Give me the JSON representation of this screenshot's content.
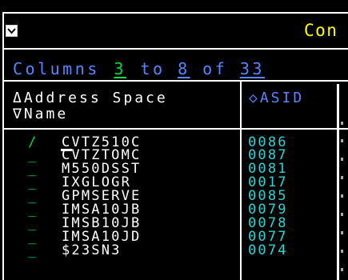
{
  "header": {
    "title": "Con",
    "checkbox_icon": "chevron-down-icon"
  },
  "columns_nav": {
    "prefix": "Columns",
    "from_value": "3",
    "to_word": "to",
    "to_value": "8",
    "of_word": "of",
    "total": "33"
  },
  "table": {
    "headers": {
      "name_line1": "ΔAddress Space",
      "name_line2": "∇Name",
      "asid": "◇ASID"
    },
    "rows": [
      {
        "sel": "/",
        "name": "CVTZ510C",
        "asid": "0086"
      },
      {
        "sel": "_",
        "name": "CVTZTOMC",
        "asid": "0087"
      },
      {
        "sel": "_",
        "name": "M550DSST",
        "asid": "0081"
      },
      {
        "sel": "_",
        "name": "IXGLOGR",
        "asid": "0017"
      },
      {
        "sel": "_",
        "name": "GPMSERVE",
        "asid": "0085"
      },
      {
        "sel": "_",
        "name": "IMSA10JB",
        "asid": "0079"
      },
      {
        "sel": "_",
        "name": "IMSB10JB",
        "asid": "0078"
      },
      {
        "sel": "_",
        "name": "IMSA10JD",
        "asid": "0077"
      },
      {
        "sel": "_",
        "name": "$23SN3",
        "asid": "0074"
      }
    ]
  },
  "colors": {
    "background": "#000000",
    "title": "#ffff00",
    "nav": "#5a84ff",
    "input": "#00dd44",
    "asid": "#2ad4d4",
    "text": "#ffffff"
  }
}
